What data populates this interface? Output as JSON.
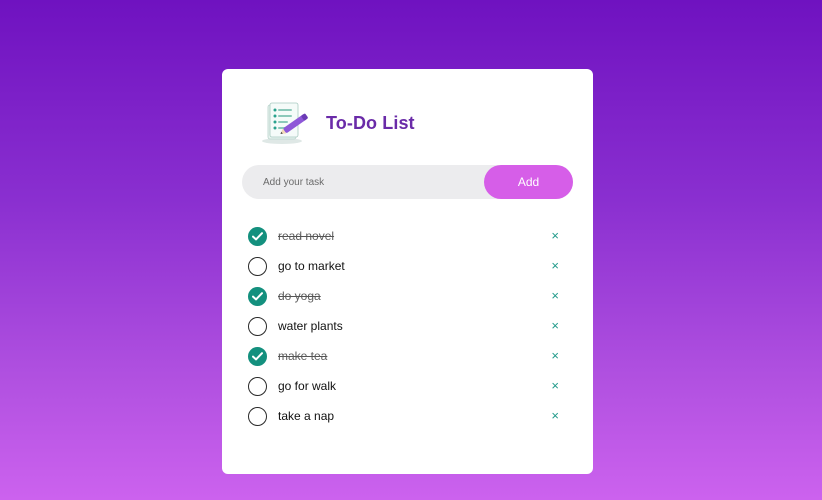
{
  "app": {
    "title": "To-Do List",
    "logo_icon": "notepad-pen-icon"
  },
  "input": {
    "placeholder": "Add your task",
    "value": "",
    "add_label": "Add"
  },
  "tasks": [
    {
      "text": "read novel",
      "done": true
    },
    {
      "text": "go to market",
      "done": false
    },
    {
      "text": "do yoga",
      "done": true
    },
    {
      "text": "water plants",
      "done": false
    },
    {
      "text": "make tea",
      "done": true
    },
    {
      "text": "go for walk",
      "done": false
    },
    {
      "text": "take a nap",
      "done": false
    }
  ],
  "delete_symbol": "×",
  "colors": {
    "accent": "#6a2ba8",
    "add_button": "#d65ee8",
    "check_done": "#14907e",
    "delete": "#1f9a8a"
  }
}
